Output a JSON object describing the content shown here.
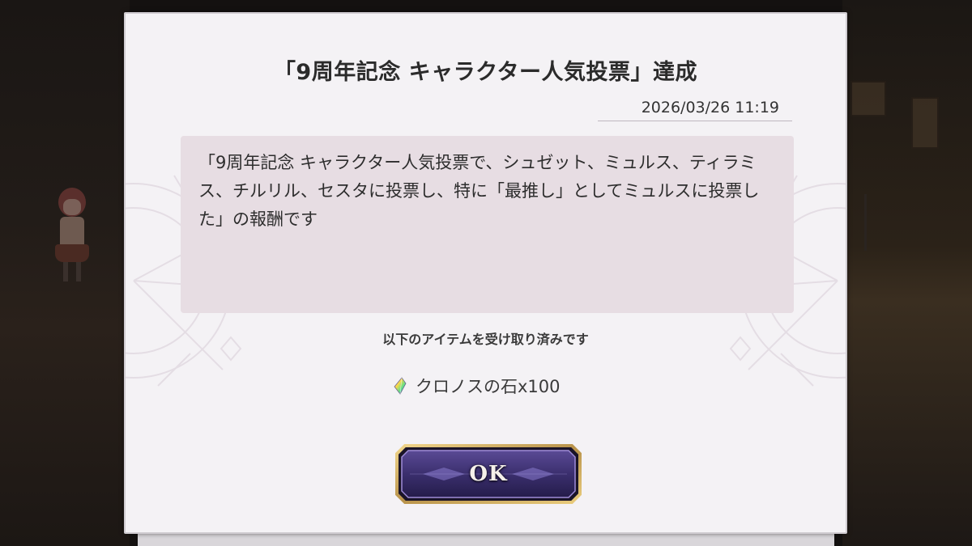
{
  "dialog": {
    "title": "「9周年記念 キャラクター人気投票」達成",
    "timestamp": "2026/03/26 11:19",
    "message": "「9周年記念 キャラクター人気投票で、シュゼット、ミュルス、ティラミス、チルリル、セスタに投票し、特に「最推し」としてミュルスに投票した」の報酬です",
    "received_note": "以下のアイテムを受け取り済みです",
    "reward": {
      "icon": "chronos-stone-icon",
      "label": "クロノスの石x100"
    },
    "ok_label": "OK"
  },
  "colors": {
    "dialog_bg": "#f4f2f5",
    "message_bg": "#e7dde3",
    "button_fill": "#3b2f6e",
    "button_border": "#c9a85a"
  }
}
